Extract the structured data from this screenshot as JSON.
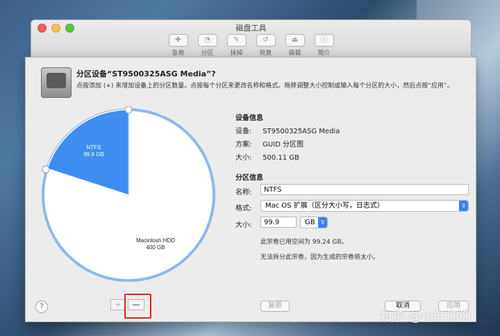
{
  "window": {
    "title": "磁盘工具",
    "toolbar": [
      {
        "label": "急救",
        "icon": "first-aid-icon"
      },
      {
        "label": "分区",
        "icon": "partition-icon"
      },
      {
        "label": "抹掉",
        "icon": "erase-icon"
      },
      {
        "label": "恢复",
        "icon": "restore-icon"
      },
      {
        "label": "装载",
        "icon": "mount-icon"
      },
      {
        "label": "简介",
        "icon": "info-icon"
      }
    ]
  },
  "sheet": {
    "title": "分区设备“ST9500325ASG Media”?",
    "description": "点按添加 (+) 来增加设备上的分区数量。点按每个分区来更改名称和格式。拖移调整大小控制或输入每个分区的大小，然后点按“应用”。"
  },
  "pie": {
    "partitions": [
      {
        "name": "NTFS",
        "size": "99.9 GB",
        "color": "#3d8ef0",
        "fraction": 0.2
      },
      {
        "name": "Macintosh HDD",
        "size": "400 GB",
        "color": "#ffffff",
        "fraction": 0.8
      }
    ]
  },
  "device_info": {
    "title": "设备信息",
    "rows": [
      {
        "label": "设备:",
        "value": "ST9500325ASG Media"
      },
      {
        "label": "方案:",
        "value": "GUID 分区图"
      },
      {
        "label": "大小:",
        "value": "500.11 GB"
      }
    ]
  },
  "partition_info": {
    "title": "分区信息",
    "name_label": "名称:",
    "name_value": "NTFS",
    "format_label": "格式:",
    "format_value": "Mac OS 扩展（区分大小写，日志式）",
    "size_label": "大小:",
    "size_value": "99.9",
    "size_unit": "GB",
    "note_used": "此宗卷已用空间为 99.24 GB。",
    "note_cannot_split": "无法拆分此宗卷，因为生成的宗卷将太小。"
  },
  "buttons": {
    "help": "?",
    "add": "+",
    "remove": "—",
    "revert": "复原",
    "cancel": "取消",
    "apply": "应用"
  },
  "watermark": "知乎 @小叶阁阁"
}
